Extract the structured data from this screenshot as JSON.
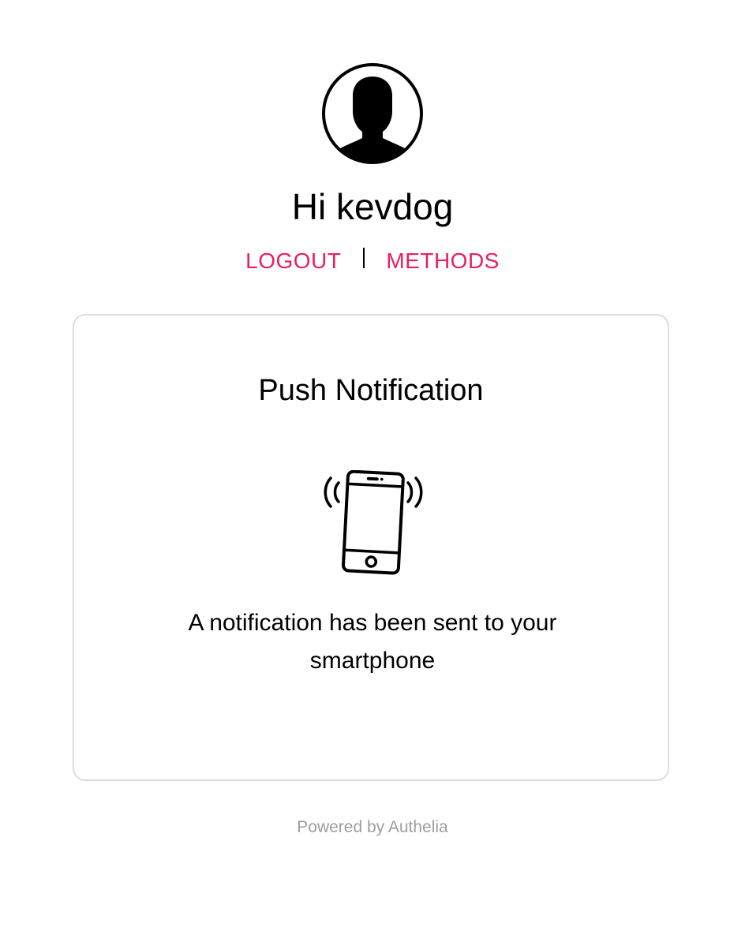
{
  "header": {
    "avatar_icon": "user-avatar-icon",
    "greeting": "Hi kevdog",
    "logout_label": "LOGOUT",
    "methods_label": "METHODS",
    "accent_color": "#e91e63"
  },
  "card": {
    "title": "Push Notification",
    "icon": "vibrating-smartphone-icon",
    "message": "A notification has been sent to your smartphone"
  },
  "footer": {
    "text": "Powered by Authelia",
    "color": "#9e9e9e"
  }
}
